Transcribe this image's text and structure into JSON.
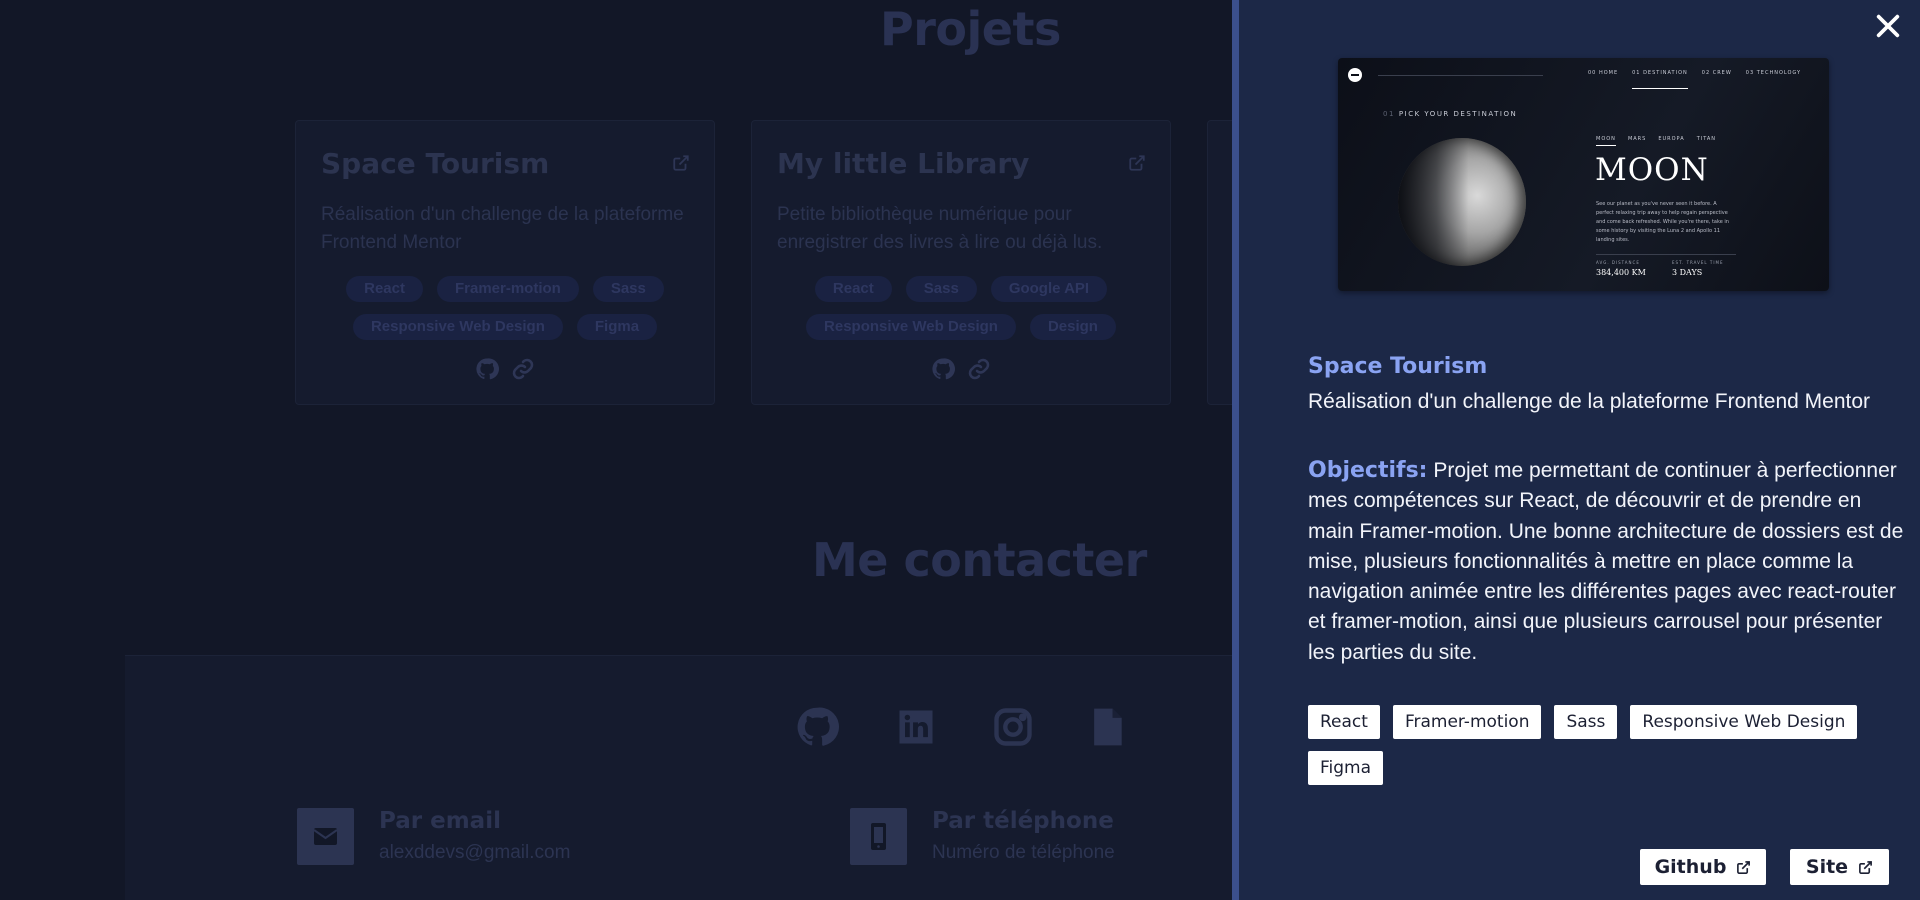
{
  "sections": {
    "projects_title": "Projets",
    "contact_title": "Me contacter"
  },
  "cards": [
    {
      "title": "Space Tourism",
      "description": "Réalisation d'un challenge de la plateforme Frontend Mentor",
      "tags": [
        "React",
        "Framer-motion",
        "Sass",
        "Responsive Web Design",
        "Figma"
      ]
    },
    {
      "title": "My little Library",
      "description": "Petite bibliothèque numérique pour enregistrer des livres à lire ou déjà lus.",
      "tags": [
        "React",
        "Sass",
        "Google API",
        "Responsive Web Design",
        "Design"
      ]
    }
  ],
  "contact": {
    "social_icons": [
      "github-icon",
      "linkedin-icon",
      "instagram-icon",
      "document-icon"
    ],
    "email": {
      "label": "Par email",
      "value": "alexddevs@gmail.com",
      "icon": "envelope-icon"
    },
    "phone": {
      "label": "Par téléphone",
      "value": "Numéro de téléphone",
      "icon": "phone-icon"
    }
  },
  "drawer": {
    "close_icon": "close-icon",
    "preview": {
      "nav": [
        "00 HOME",
        "01 DESTINATION",
        "02 CREW",
        "03 TECHNOLOGY"
      ],
      "pick_number": "01",
      "pick_text": "PICK YOUR DESTINATION",
      "tabs": [
        "MOON",
        "MARS",
        "EUROPA",
        "TITAN"
      ],
      "heading": "MOON",
      "description": "See our planet as you've never seen it before. A perfect relaxing trip away to help regain perspective and come back refreshed. While you're there, take in some history by visiting the Luna 2 and Apollo 11 landing sites.",
      "stat1_label": "AVG. DISTANCE",
      "stat1_value": "384,400 KM",
      "stat2_label": "EST. TRAVEL TIME",
      "stat2_value": "3 DAYS"
    },
    "title": "Space Tourism",
    "subtitle": "Réalisation d'un challenge de la plateforme Frontend Mentor",
    "objectives_label": "Objectifs:",
    "objectives_text": "Projet me permettant de continuer à perfectionner mes compétences sur React, de découvrir et de prendre en main Framer-motion. Une bonne architecture de dossiers est de mise, plusieurs fonctionnalités à mettre en place comme la navigation animée entre les différentes pages avec react-router et framer-motion, ainsi que plusieurs carrousel pour présenter les parties du site.",
    "tags": [
      "React",
      "Framer-motion",
      "Sass",
      "Responsive Web Design",
      "Figma"
    ],
    "buttons": {
      "github": "Github",
      "site": "Site"
    }
  },
  "colors": {
    "background": "#121727",
    "drawer_bg": "#1c2847",
    "accent": "#8aa3f2",
    "drawer_border": "#3b4f8c"
  }
}
